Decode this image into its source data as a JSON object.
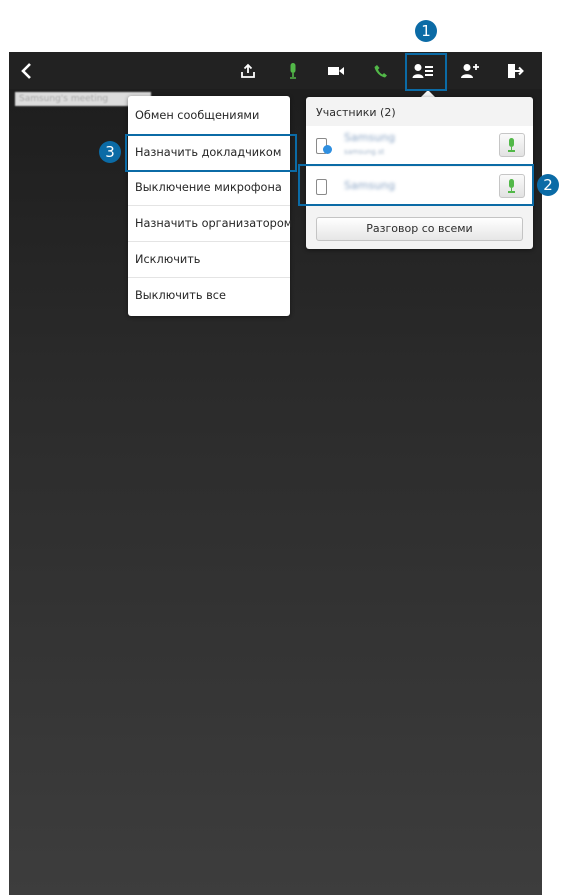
{
  "callouts": [
    "1",
    "2",
    "3"
  ],
  "meeting_banner": "Samsung's meeting",
  "toolbar": {
    "back_icon": "chevron-left-icon",
    "icons": [
      "share-icon",
      "microphone-icon",
      "video-camera-icon",
      "phone-icon",
      "participants-list-icon",
      "add-person-icon",
      "exit-icon"
    ],
    "mic_color": "#52b848",
    "phone_color": "#52b848"
  },
  "context_menu": {
    "items": [
      "Обмен сообщениями",
      "Назначить докладчиком",
      "Выключение микрофона",
      "Назначить организатором",
      "Исключить",
      "Выключить все"
    ]
  },
  "participants_panel": {
    "title": "Участники (2)",
    "participants": [
      {
        "name": "Samsung",
        "detail": "samsung.st"
      },
      {
        "name": "Samsung"
      }
    ],
    "talk_all_label": "Разговор со всеми"
  },
  "colors": {
    "callout": "#0b6ba6",
    "mic": "#52b848"
  }
}
